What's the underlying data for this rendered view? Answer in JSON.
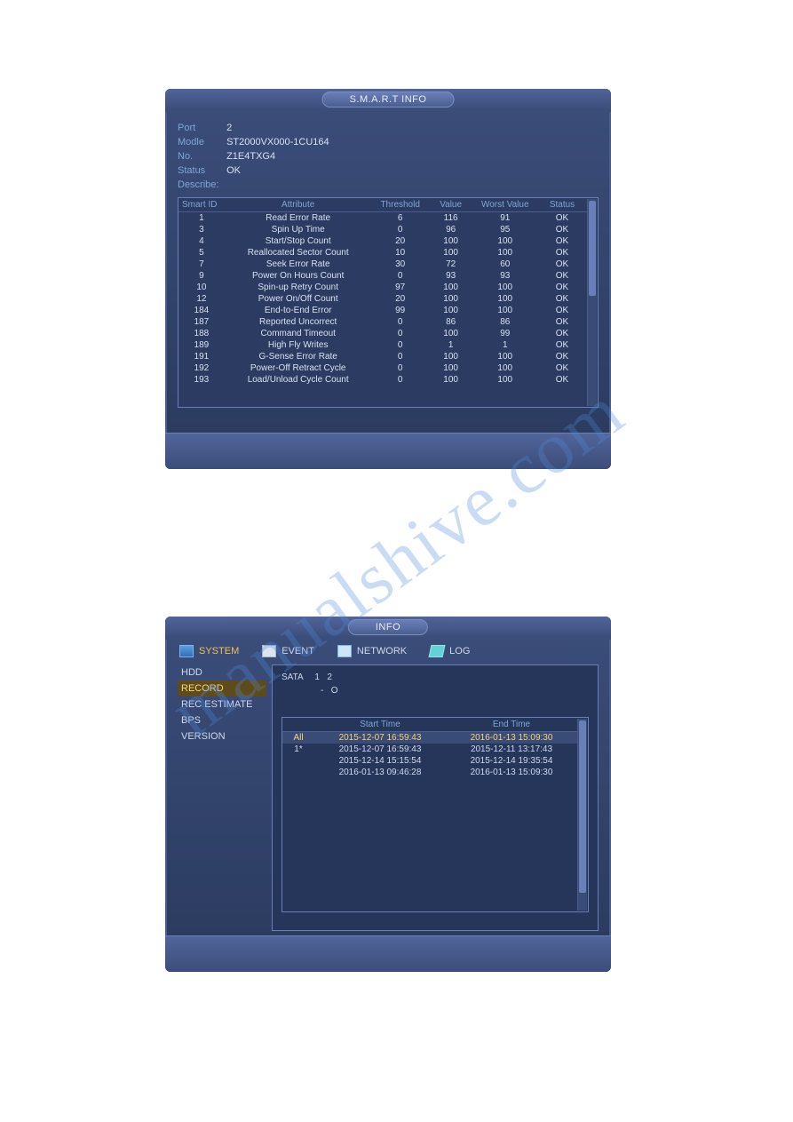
{
  "watermark": "manualshive.com",
  "panel1": {
    "title": "S.M.A.R.T INFO",
    "fields": {
      "port_label": "Port",
      "port_value": "2",
      "modle_label": "Modle",
      "modle_value": "ST2000VX000-1CU164",
      "no_label": "No.",
      "no_value": "Z1E4TXG4",
      "status_label": "Status",
      "status_value": "OK",
      "describe_label": "Describe:"
    },
    "columns": [
      "Smart ID",
      "Attribute",
      "Threshold",
      "Value",
      "Worst Value",
      "Status"
    ],
    "rows": [
      {
        "id": "1",
        "attr": "Read Error Rate",
        "th": "6",
        "val": "116",
        "worst": "91",
        "st": "OK"
      },
      {
        "id": "3",
        "attr": "Spin Up Time",
        "th": "0",
        "val": "96",
        "worst": "95",
        "st": "OK"
      },
      {
        "id": "4",
        "attr": "Start/Stop Count",
        "th": "20",
        "val": "100",
        "worst": "100",
        "st": "OK"
      },
      {
        "id": "5",
        "attr": "Reallocated Sector Count",
        "th": "10",
        "val": "100",
        "worst": "100",
        "st": "OK"
      },
      {
        "id": "7",
        "attr": "Seek Error Rate",
        "th": "30",
        "val": "72",
        "worst": "60",
        "st": "OK"
      },
      {
        "id": "9",
        "attr": "Power On Hours Count",
        "th": "0",
        "val": "93",
        "worst": "93",
        "st": "OK"
      },
      {
        "id": "10",
        "attr": "Spin-up Retry Count",
        "th": "97",
        "val": "100",
        "worst": "100",
        "st": "OK"
      },
      {
        "id": "12",
        "attr": "Power On/Off Count",
        "th": "20",
        "val": "100",
        "worst": "100",
        "st": "OK"
      },
      {
        "id": "184",
        "attr": "End-to-End Error",
        "th": "99",
        "val": "100",
        "worst": "100",
        "st": "OK"
      },
      {
        "id": "187",
        "attr": "Reported Uncorrect",
        "th": "0",
        "val": "86",
        "worst": "86",
        "st": "OK"
      },
      {
        "id": "188",
        "attr": "Command Timeout",
        "th": "0",
        "val": "100",
        "worst": "99",
        "st": "OK"
      },
      {
        "id": "189",
        "attr": "High Fly Writes",
        "th": "0",
        "val": "1",
        "worst": "1",
        "st": "OK"
      },
      {
        "id": "191",
        "attr": "G-Sense Error Rate",
        "th": "0",
        "val": "100",
        "worst": "100",
        "st": "OK"
      },
      {
        "id": "192",
        "attr": "Power-Off Retract Cycle",
        "th": "0",
        "val": "100",
        "worst": "100",
        "st": "OK"
      },
      {
        "id": "193",
        "attr": "Load/Unload Cycle Count",
        "th": "0",
        "val": "100",
        "worst": "100",
        "st": "OK"
      }
    ]
  },
  "panel2": {
    "title": "INFO",
    "tabs": {
      "system": "SYSTEM",
      "event": "EVENT",
      "network": "NETWORK",
      "log": "LOG"
    },
    "sidebar": [
      "HDD",
      "RECORD",
      "REC ESTIMATE",
      "BPS",
      "VERSION"
    ],
    "sidebar_selected": 1,
    "sata": {
      "label": "SATA",
      "v1": "1",
      "v2": "2",
      "dash": "-",
      "circle": "O"
    },
    "rec_columns": [
      "",
      "Start Time",
      "End Time"
    ],
    "rec_rows": [
      {
        "idx": "All",
        "start": "2015-12-07 16:59:43",
        "end": "2016-01-13 15:09:30",
        "hl": true
      },
      {
        "idx": "1*",
        "start": "2015-12-07 16:59:43",
        "end": "2015-12-11 13:17:43",
        "hl": false
      },
      {
        "idx": "",
        "start": "2015-12-14 15:15:54",
        "end": "2015-12-14 19:35:54",
        "hl": false
      },
      {
        "idx": "",
        "start": "2016-01-13 09:46:28",
        "end": "2016-01-13 15:09:30",
        "hl": false
      }
    ]
  }
}
